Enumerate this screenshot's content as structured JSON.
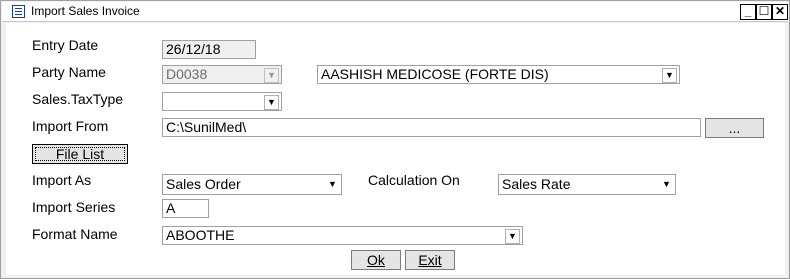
{
  "window": {
    "title": "Import Sales Invoice",
    "min_label": "_",
    "max_label": "☐",
    "close_label": "✕"
  },
  "form": {
    "entry_date_label": "Entry Date",
    "entry_date_value": "26/12/18",
    "party_name_label": "Party Name",
    "party_code_value": "D0038",
    "party_name_value": "AASHISH MEDICOSE (FORTE DIS)",
    "sales_tax_type_label": "Sales.TaxType",
    "sales_tax_type_value": "",
    "import_from_label": "Import From",
    "import_from_value": "C:\\SunilMed\\",
    "browse_label": "...",
    "file_list_label": "File List",
    "import_as_label": "Import As",
    "import_as_value": "Sales Order",
    "calculation_on_label": "Calculation On",
    "calculation_on_value": "Sales Rate",
    "import_series_label": "Import Series",
    "import_series_value": "A",
    "format_name_label": "Format Name",
    "format_name_value": "ABOOTHE"
  },
  "buttons": {
    "ok_label": "Ok",
    "exit_label": "Exit"
  },
  "icons": {
    "dropdown": "▼"
  }
}
